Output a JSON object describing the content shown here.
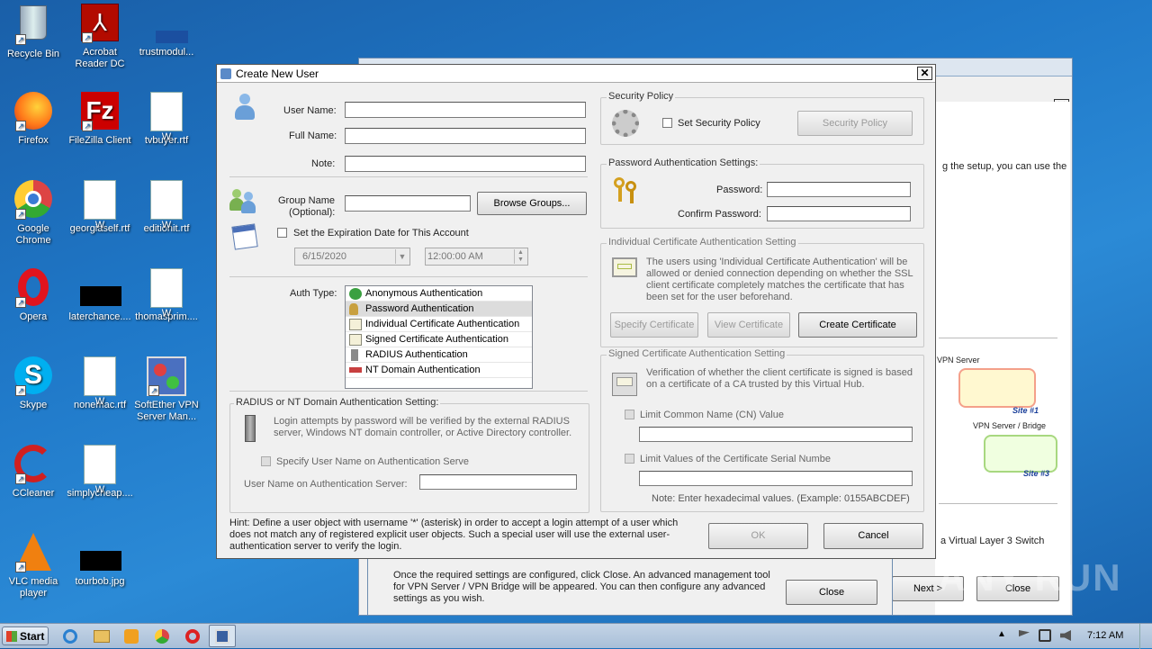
{
  "desktop": {
    "icons": [
      {
        "label": "Recycle Bin"
      },
      {
        "label": "Acrobat Reader DC"
      },
      {
        "label": "trustmodul..."
      },
      {
        "label": "Firefox"
      },
      {
        "label": "FileZilla Client"
      },
      {
        "label": "tvbuyer.rtf"
      },
      {
        "label": "Google Chrome"
      },
      {
        "label": "georgiaself.rtf"
      },
      {
        "label": "editionit.rtf"
      },
      {
        "label": "Opera"
      },
      {
        "label": "laterchance...."
      },
      {
        "label": "thomasprim...."
      },
      {
        "label": "Skype"
      },
      {
        "label": "nonemac.rtf"
      },
      {
        "label": "SoftEther VPN Server Man..."
      },
      {
        "label": "CCleaner"
      },
      {
        "label": "simplycheap...."
      },
      {
        "label": "VLC media player"
      },
      {
        "label": "tourbob.jpg"
      }
    ]
  },
  "bg_window": {
    "text1": "g the setup, you can use the",
    "vpn_server": "VPN Server",
    "vpn_bridge": "VPN Server / Bridge",
    "site1": "Site #1",
    "site3": "Site #3",
    "layer3": "a Virtual Layer 3 Switch",
    "next": "Next >",
    "close": "Close",
    "close2": "Close",
    "bottom_text": "Once the required settings are configured, click Close. An advanced management tool for VPN Server / VPN Bridge will be appeared. You can then configure any advanced settings as you wish."
  },
  "dialog": {
    "title": "Create New User",
    "user_name_label": "User Name:",
    "full_name_label": "Full Name:",
    "note_label": "Note:",
    "group_label_1": "Group Name",
    "group_label_2": "(Optional):",
    "browse_groups": "Browse Groups...",
    "expiration_label": "Set the Expiration Date for This Account",
    "date_value": "6/15/2020",
    "time_value": "12:00:00 AM",
    "auth_type_label": "Auth Type:",
    "auth_types": [
      "Anonymous Authentication",
      "Password Authentication",
      "Individual Certificate Authentication",
      "Signed Certificate Authentication",
      "RADIUS Authentication",
      "NT Domain Authentication"
    ],
    "radius_group": "RADIUS or NT Domain Authentication Setting:",
    "radius_text": "Login attempts by password will be verified by the external RADIUS server, Windows NT domain controller, or Active Directory controller.",
    "specify_user": "Specify User Name on Authentication Serve",
    "user_on_server": "User Name on Authentication Server:",
    "security_policy_group": "Security Policy",
    "set_security_policy": "Set Security Policy",
    "security_policy_btn": "Security Policy",
    "password_group": "Password Authentication Settings:",
    "password_label": "Password:",
    "confirm_label": "Confirm Password:",
    "indiv_group": "Individual Certificate Authentication Setting",
    "indiv_text": "The users using 'Individual Certificate Authentication' will be allowed or denied connection depending on whether the SSL client certificate completely matches the certificate that has been set for the user beforehand.",
    "specify_cert": "Specify Certificate",
    "view_cert": "View Certificate",
    "create_cert": "Create Certificate",
    "signed_group": "Signed Certificate Authentication Setting",
    "signed_text": "Verification of whether the client certificate is signed is based on a certificate of a CA trusted by this Virtual Hub.",
    "limit_cn": "Limit Common Name (CN) Value",
    "limit_serial": "Limit Values of the Certificate Serial Numbe",
    "hex_note": "Note: Enter hexadecimal values. (Example: 0155ABCDEF)",
    "hint": "Hint: Define a user object with username '*' (asterisk) in order to accept a login attempt of a user which does not match any of registered explicit user objects. Such a special user will use the external user-authentication server to verify the login.",
    "ok": "OK",
    "cancel": "Cancel"
  },
  "taskbar": {
    "start": "Start",
    "time": "7:12 AM"
  },
  "watermark": "ANY RUN"
}
